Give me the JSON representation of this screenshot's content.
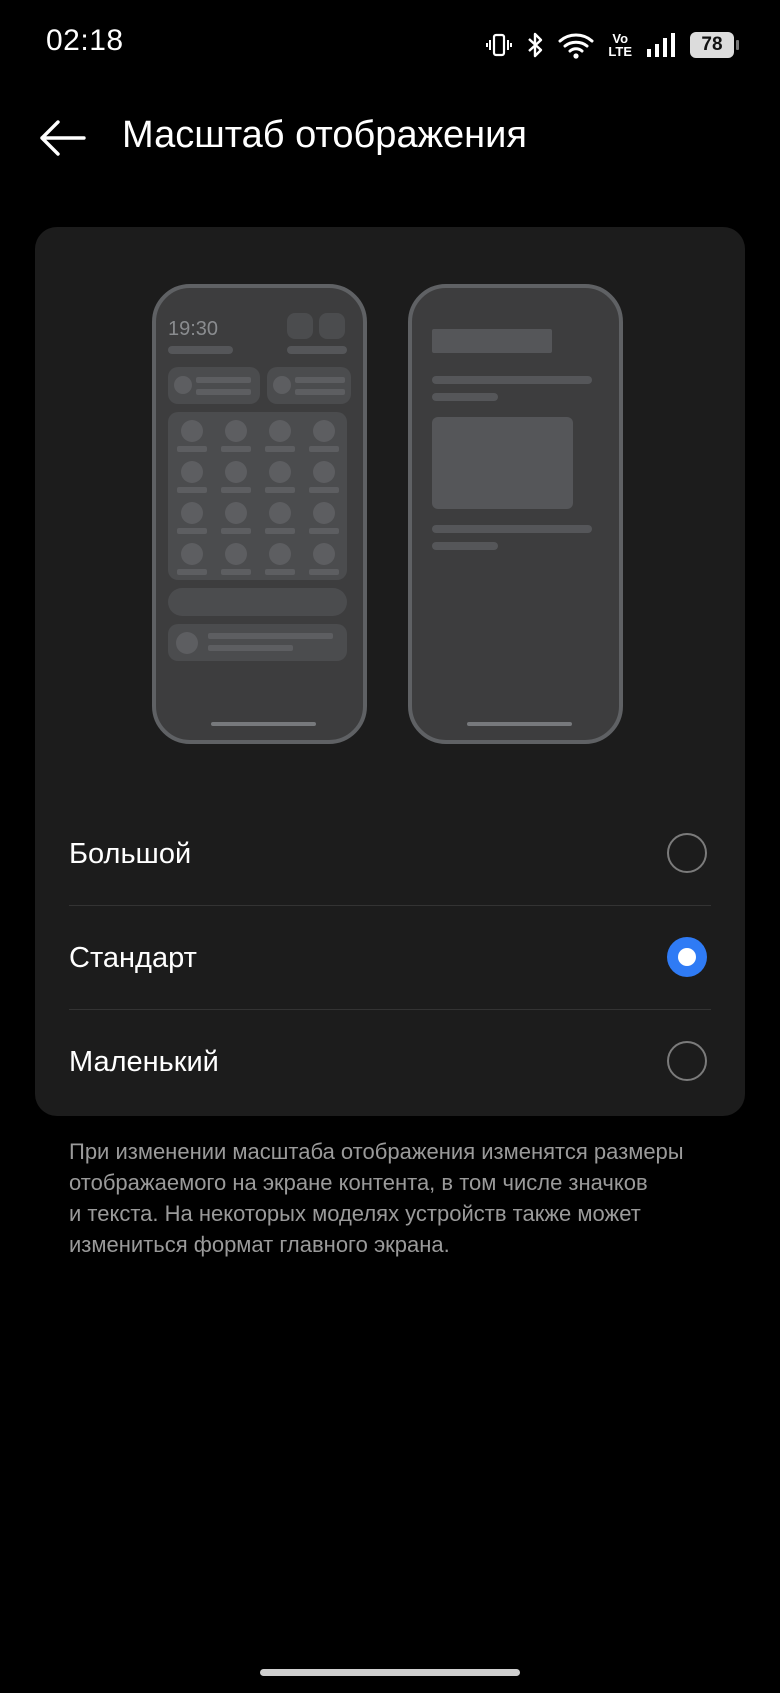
{
  "status_bar": {
    "time": "02:18",
    "battery": "78",
    "icons": [
      "vibrate-icon",
      "bluetooth-icon",
      "wifi-icon",
      "volte-icon",
      "signal-icon",
      "battery-icon"
    ],
    "volte_top": "Vo",
    "volte_bottom": "LTE"
  },
  "header": {
    "back_icon": "arrow-left-icon",
    "title": "Масштаб отображения"
  },
  "preview": {
    "clock": "19:30"
  },
  "options": [
    {
      "label": "Большой",
      "selected": false
    },
    {
      "label": "Стандарт",
      "selected": true
    },
    {
      "label": "Маленький",
      "selected": false
    }
  ],
  "description": {
    "lines": [
      "При изменении масштаба отображения изменятся размеры",
      "отображаемого на экране контента, в том числе значков",
      "и текста. На некоторых моделях устройств также может",
      "измениться формат главного экрана."
    ]
  },
  "colors": {
    "background": "#000000",
    "card": "#1c1c1c",
    "accent": "#2f7bf5",
    "secondary_text": "#9a9a9a"
  }
}
